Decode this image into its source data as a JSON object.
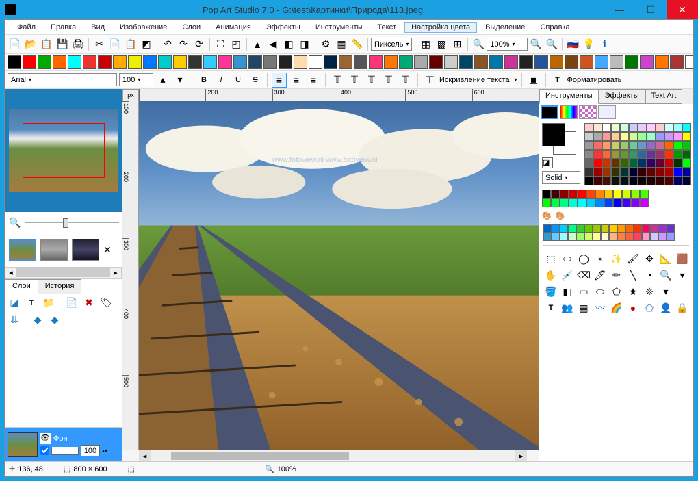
{
  "window": {
    "title": "Pop Art Studio 7.0 - G:\\test\\Картинки\\Природа\\113.jpeg"
  },
  "menu": [
    "Файл",
    "Правка",
    "Вид",
    "Изображение",
    "Слои",
    "Анимация",
    "Эффекты",
    "Инструменты",
    "Текст",
    "Настройка цвета",
    "Выделение",
    "Справка"
  ],
  "menu_active_index": 9,
  "toolbar1": {
    "unit_label": "Пиксель",
    "zoom_value": "100%"
  },
  "effects_colors": [
    "#000",
    "#f00",
    "#0a0",
    "#f60",
    "#0ff",
    "#e33",
    "#c00",
    "#fa0",
    "#ee0",
    "#07f",
    "#0cc",
    "#fc0",
    "#333",
    "#3cf",
    "#f39",
    "#3394d1",
    "#246",
    "#777",
    "#222",
    "#fda",
    "#fff",
    "#024",
    "#963",
    "#555",
    "#f37",
    "#f70",
    "#0a7",
    "#aaa",
    "#600",
    "#ccc",
    "#046",
    "#852",
    "#07a",
    "#c39",
    "#222",
    "#259",
    "#b60",
    "#741",
    "#c52",
    "#4af",
    "#bbb",
    "#070",
    "#c4c",
    "#f70",
    "#a33",
    "#fff",
    "#0c0",
    "#f0f",
    "#a11",
    "#852",
    "#ad5",
    "#ff7",
    "#420",
    "#ffb380",
    "#9c6",
    "#fd5"
  ],
  "text_toolbar": {
    "font": "Arial",
    "size": "100",
    "warp_label": "Искривление текста",
    "format_label": "Форматировать"
  },
  "ruler_unit": "px",
  "ruler_h_ticks": [
    "",
    "200",
    "300",
    "400",
    "500",
    "600"
  ],
  "ruler_v_ticks": [
    "100",
    "200",
    "300",
    "400",
    "500"
  ],
  "left": {
    "tabs": [
      "Слои",
      "История"
    ],
    "layer_name": "Фон",
    "layer_opacity": "100"
  },
  "right": {
    "tabs": [
      "Инструменты",
      "Эффекты",
      "Text Art"
    ],
    "solid_label": "Solid",
    "palette": [
      "#ffcccc",
      "#ffe6cc",
      "#fff",
      "#e6ffcc",
      "#ccffe6",
      "#ccf",
      "#e6ccff",
      "#ffccff",
      "#fcc",
      "#cff",
      "#9ff",
      "#0ff",
      "#ccc",
      "#aaa",
      "#f99",
      "#fc9",
      "#ff9",
      "#cf9",
      "#9f9",
      "#9fc",
      "#99f",
      "#c9f",
      "#f9f",
      "#ff0",
      "#999",
      "#f66",
      "#f96",
      "#cc6",
      "#9c6",
      "#6c9",
      "#69c",
      "#96c",
      "#c69",
      "#f60",
      "#0f0",
      "#0c0",
      "#888",
      "#f33",
      "#f63",
      "#993",
      "#693",
      "#396",
      "#369",
      "#639",
      "#936",
      "#f30",
      "#090",
      "#060",
      "#666",
      "#f00",
      "#c30",
      "#630",
      "#360",
      "#063",
      "#036",
      "#306",
      "#603",
      "#c00",
      "#030",
      "#0f0",
      "#333",
      "#900",
      "#930",
      "#330",
      "#033",
      "#003",
      "#300",
      "#600",
      "#800",
      "#a00",
      "#00f",
      "#009",
      "#000",
      "#400",
      "#410",
      "#110",
      "#011",
      "#001",
      "#100",
      "#200",
      "#300",
      "#500",
      "#006",
      "#003"
    ],
    "palette2": [
      "#000",
      "#400",
      "#800",
      "#c00",
      "#f00",
      "#f40",
      "#f80",
      "#fc0",
      "#ff0",
      "#cf0",
      "#8f0",
      "#4f0",
      "#0f0",
      "#0f4",
      "#0f8",
      "#0fc",
      "#0ff",
      "#0cf",
      "#08f",
      "#04f",
      "#00f",
      "#40f",
      "#80f",
      "#c0f"
    ],
    "wide_palette": [
      "#06c",
      "#09f",
      "#0cf",
      "#0f8",
      "#3c3",
      "#6c0",
      "#9c0",
      "#cc0",
      "#fc0",
      "#f90",
      "#f60",
      "#f30",
      "#f06",
      "#c39",
      "#93c",
      "#63c",
      "#39c",
      "#6cf",
      "#9ff",
      "#cfc",
      "#9f6",
      "#cf6",
      "#ff9",
      "#ffc",
      "#ffb380",
      "#ff8040",
      "#ff6040",
      "#ff4060",
      "#f9c",
      "#ccf",
      "#c9f",
      "#99f"
    ]
  },
  "status": {
    "coords": "136, 48",
    "dims": "800 × 600",
    "zoom": "100%"
  }
}
